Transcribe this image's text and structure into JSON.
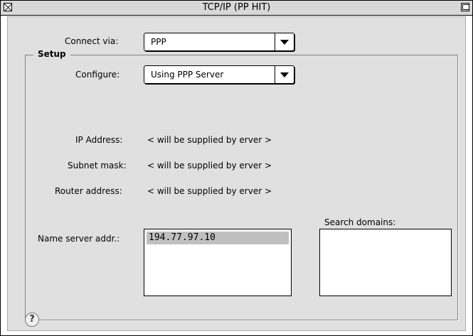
{
  "window": {
    "title": "TCP/IP (PP HIT)"
  },
  "connect": {
    "label": "Connect via:",
    "value": "PPP"
  },
  "setup": {
    "group_title": "Setup",
    "configure_label": "Configure:",
    "configure_value": "Using PPP Server",
    "ip_label": "IP Address:",
    "ip_value": "< will be supplied by erver >",
    "subnet_label": "Subnet mask:",
    "subnet_value": "< will be supplied by erver >",
    "router_label": "Router address:",
    "router_value": "< will be supplied by erver >",
    "name_server_label": "Name server addr.:",
    "name_servers": [
      "194.77.97.10"
    ],
    "search_domains_label": "Search domains:"
  },
  "icons": {
    "close": "close-box-icon",
    "zoom": "zoom-box-icon",
    "help": "help-icon"
  }
}
